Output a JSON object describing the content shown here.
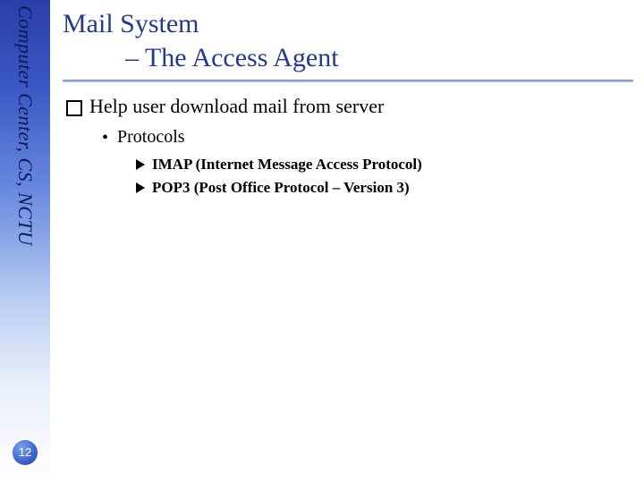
{
  "sidebar": {
    "org": "Computer Center, CS, NCTU",
    "page_number": "12"
  },
  "title": {
    "line1": "Mail System",
    "line2": "– The Access Agent"
  },
  "main_point": "Help user download mail from server",
  "sub_heading": "Protocols",
  "protocols": {
    "p1": "IMAP (Internet Message Access Protocol)",
    "p2": "POP3 (Post Office Protocol – Version 3)"
  }
}
